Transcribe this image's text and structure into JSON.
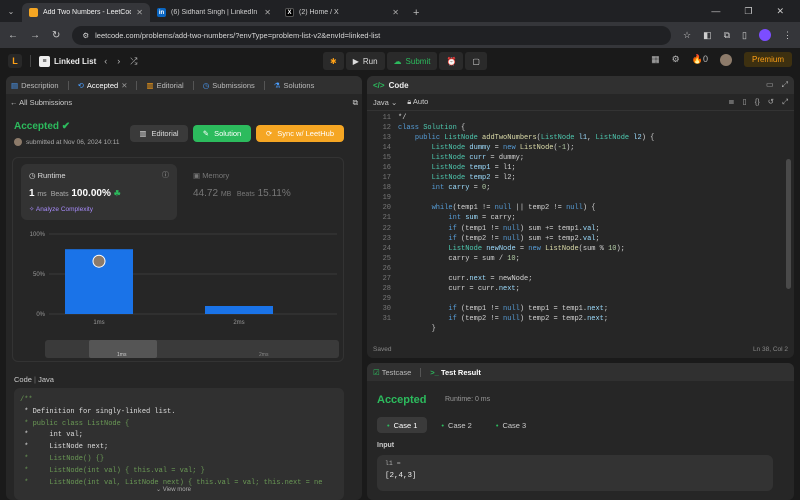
{
  "browser": {
    "tabs": [
      {
        "title": "Add Two Numbers - LeetCode",
        "fav_bg": "#f5a623",
        "fav": "L"
      },
      {
        "title": "(6) Sidhant Singh | LinkedIn",
        "fav_bg": "#0a66c2",
        "fav": "in"
      },
      {
        "title": "(2) Home / X",
        "fav_bg": "#000000",
        "fav": "X"
      }
    ],
    "url": "leetcode.com/problems/add-two-numbers/?envType=problem-list-v2&envId=linked-list"
  },
  "nav": {
    "list_label": "Linked List",
    "run": "Run",
    "submit": "Submit",
    "streak": "0",
    "premium": "Premium"
  },
  "left": {
    "tabs": [
      "Description",
      "Accepted",
      "Editorial",
      "Submissions",
      "Solutions"
    ],
    "all_submissions": "All Submissions",
    "status": "Accepted",
    "submitted": "submitted at Nov 06, 2024 10:11",
    "btn_editorial": "Editorial",
    "btn_solution": "Solution",
    "btn_sync": "Sync w/ LeetHub",
    "runtime_label": "Runtime",
    "runtime_value": "1",
    "runtime_unit": "ms",
    "runtime_beats_label": "Beats",
    "runtime_beats": "100.00%",
    "analyze": "Analyze Complexity",
    "memory_label": "Memory",
    "memory_value": "44.72",
    "memory_unit": "MB",
    "memory_beats_label": "Beats",
    "memory_beats": "15.11%",
    "code_label": "Code",
    "code_lang": "Java",
    "view_more": "View more",
    "code_lines": [
      "/**",
      " * Definition for singly-linked list.",
      " * public class ListNode {",
      " *     int val;",
      " *     ListNode next;",
      " *     ListNode() {}",
      " *     ListNode(int val) { this.val = val; }",
      " *     ListNode(int val, ListNode next) { this.val = val; this.next = ne"
    ]
  },
  "chart_data": {
    "type": "bar",
    "categories": [
      "1ms",
      "2ms"
    ],
    "values": [
      81,
      10
    ],
    "y_ticks": [
      "100%",
      "50%",
      "0%"
    ],
    "ylim": [
      0,
      100
    ],
    "slider_labels": [
      "1ms",
      "2ms"
    ],
    "bar_color": "#1a73e8"
  },
  "right": {
    "title": "Code",
    "lang": "Java",
    "auto": "Auto",
    "line_numbers": [
      11,
      12,
      13,
      14,
      15,
      16,
      17,
      18,
      19,
      20,
      21,
      22,
      23,
      24,
      25,
      26,
      27,
      28,
      29,
      30,
      31
    ],
    "saved": "Saved",
    "position": "Ln 38, Col 2"
  },
  "test": {
    "tab1": "Testcase",
    "tab2": "Test Result",
    "status": "Accepted",
    "runtime": "Runtime: 0 ms",
    "cases": [
      "Case 1",
      "Case 2",
      "Case 3"
    ],
    "input_label": "Input",
    "input_key": "l1 =",
    "input_value": "[2,4,3]"
  }
}
